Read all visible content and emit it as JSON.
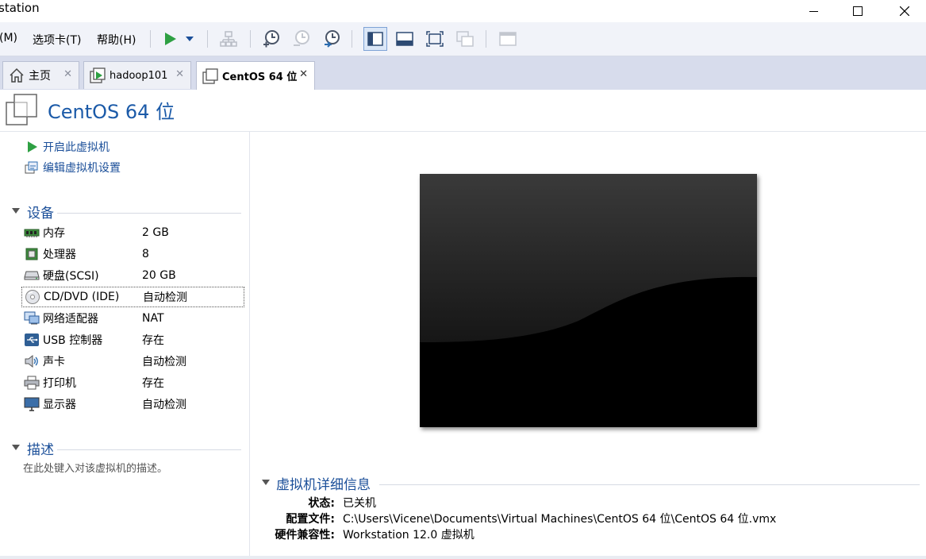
{
  "window": {
    "title": "station",
    "controls": {
      "minimize": "—",
      "maximize": "☐",
      "close": "✕"
    }
  },
  "menu": {
    "items": [
      {
        "label": "(M)"
      },
      {
        "label": "选项卡(T)"
      },
      {
        "label": "帮助(H)"
      }
    ]
  },
  "toolbar": {
    "icons": [
      "play-icon",
      "dropdown-arrow-icon",
      "network-icon",
      "snapshot-take-icon",
      "snapshot-revert-icon",
      "snapshot-manager-icon",
      "library-view-icon",
      "console-view-icon",
      "fullscreen-icon",
      "unity-icon",
      "thumbnail-icon"
    ]
  },
  "tabs": [
    {
      "label": "主页",
      "icon": "home-icon",
      "close": "✕"
    },
    {
      "label": "hadoop101",
      "icon": "vm-running-icon",
      "close": "✕"
    },
    {
      "label": "CentOS 64 位",
      "icon": "vm-icon",
      "close": "✕",
      "active": true
    }
  ],
  "vm": {
    "name": "CentOS 64 位"
  },
  "actions": {
    "start": "开启此虚拟机",
    "edit": "编辑虚拟机设置"
  },
  "devices": {
    "title": "设备",
    "items": [
      {
        "name": "内存",
        "value": "2 GB",
        "icon": "memory-icon"
      },
      {
        "name": "处理器",
        "value": "8",
        "icon": "cpu-icon"
      },
      {
        "name": "硬盘(SCSI)",
        "value": "20 GB",
        "icon": "harddisk-icon"
      },
      {
        "name": "CD/DVD (IDE)",
        "value": "自动检测",
        "icon": "cdrom-icon",
        "selected": true
      },
      {
        "name": "网络适配器",
        "value": "NAT",
        "icon": "network-adapter-icon"
      },
      {
        "name": "USB 控制器",
        "value": "存在",
        "icon": "usb-icon"
      },
      {
        "name": "声卡",
        "value": "自动检测",
        "icon": "sound-icon"
      },
      {
        "name": "打印机",
        "value": "存在",
        "icon": "printer-icon"
      },
      {
        "name": "显示器",
        "value": "自动检测",
        "icon": "display-icon"
      }
    ]
  },
  "description": {
    "title": "描述",
    "placeholder": "在此处键入对该虚拟机的描述。"
  },
  "details": {
    "title": "虚拟机详细信息",
    "rows": [
      {
        "key": "状态:",
        "value": "已关机"
      },
      {
        "key": "配置文件:",
        "value": "C:\\Users\\Vicene\\Documents\\Virtual Machines\\CentOS 64 位\\CentOS 64 位.vmx"
      },
      {
        "key": "硬件兼容性:",
        "value": "Workstation 12.0 虚拟机"
      }
    ]
  },
  "colors": {
    "accent": "#1b5aa8",
    "link": "#1b4f99",
    "toolbar_bg": "#f1f3f9",
    "tabbar_bg": "#d7dcec",
    "play_green": "#2ea043"
  }
}
